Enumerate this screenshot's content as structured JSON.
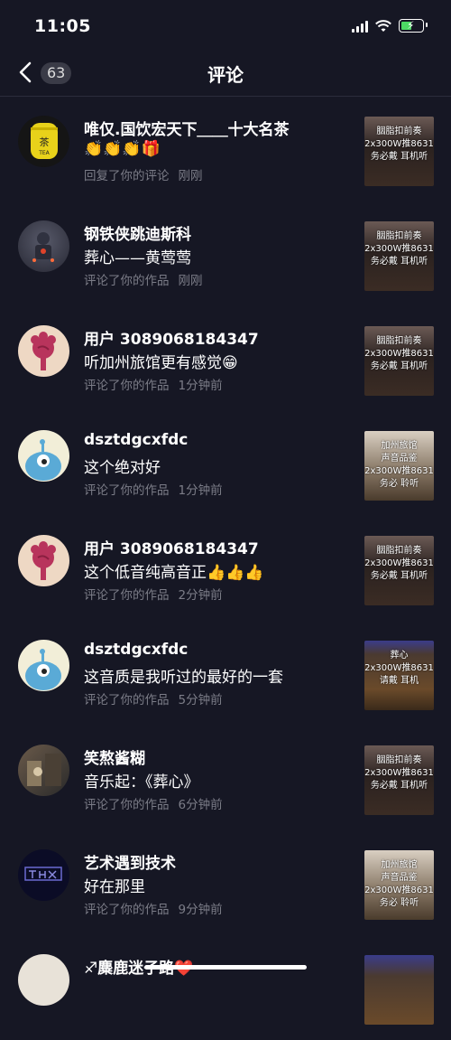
{
  "status": {
    "time": "11:05"
  },
  "nav": {
    "count": "63",
    "title": "评论"
  },
  "comments": [
    {
      "name": "唯仅.国饮宏天下＿＿十大名茶",
      "text": "👏👏👏🎁",
      "action": "回复了你的评论",
      "time": "刚刚",
      "thumb_caption": "胭脂扣前奏\n2x300W推8631\n务必戴 耳机听"
    },
    {
      "name": "钢铁侠跳迪斯科",
      "text": "葬心——黄莺莺",
      "action": "评论了你的作品",
      "time": "刚刚",
      "thumb_caption": "胭脂扣前奏\n2x300W推8631\n务必戴 耳机听"
    },
    {
      "name": "用户 3089068184347",
      "text": "听加州旅馆更有感觉😁",
      "action": "评论了你的作品",
      "time": "1分钟前",
      "thumb_caption": "胭脂扣前奏\n2x300W推8631\n务必戴 耳机听"
    },
    {
      "name": "dsztdgcxfdc",
      "text": "这个绝对好",
      "action": "评论了你的作品",
      "time": "1分钟前",
      "thumb_caption": "加州旅馆\n声音品鉴\n2x300W推8631\n务必 聆听"
    },
    {
      "name": "用户 3089068184347",
      "text": "这个低音纯高音正👍👍👍",
      "action": "评论了你的作品",
      "time": "2分钟前",
      "thumb_caption": "胭脂扣前奏\n2x300W推8631\n务必戴 耳机听"
    },
    {
      "name": "dsztdgcxfdc",
      "text": "这音质是我听过的最好的一套",
      "action": "评论了你的作品",
      "time": "5分钟前",
      "thumb_caption": "葬心\n2x300W推8631\n请戴 耳机"
    },
    {
      "name": "笑熬酱糊",
      "text": "音乐起：《葬心》",
      "action": "评论了你的作品",
      "time": "6分钟前",
      "thumb_caption": "胭脂扣前奏\n2x300W推8631\n务必戴 耳机听"
    },
    {
      "name": "艺术遇到技术",
      "text": "好在那里",
      "action": "评论了你的作品",
      "time": "9分钟前",
      "thumb_caption": "加州旅馆\n声音品鉴\n2x300W推8631\n务必 聆听"
    },
    {
      "name": "♐麋鹿迷子路❤️",
      "text": "",
      "action": "",
      "time": "",
      "thumb_caption": ""
    }
  ]
}
